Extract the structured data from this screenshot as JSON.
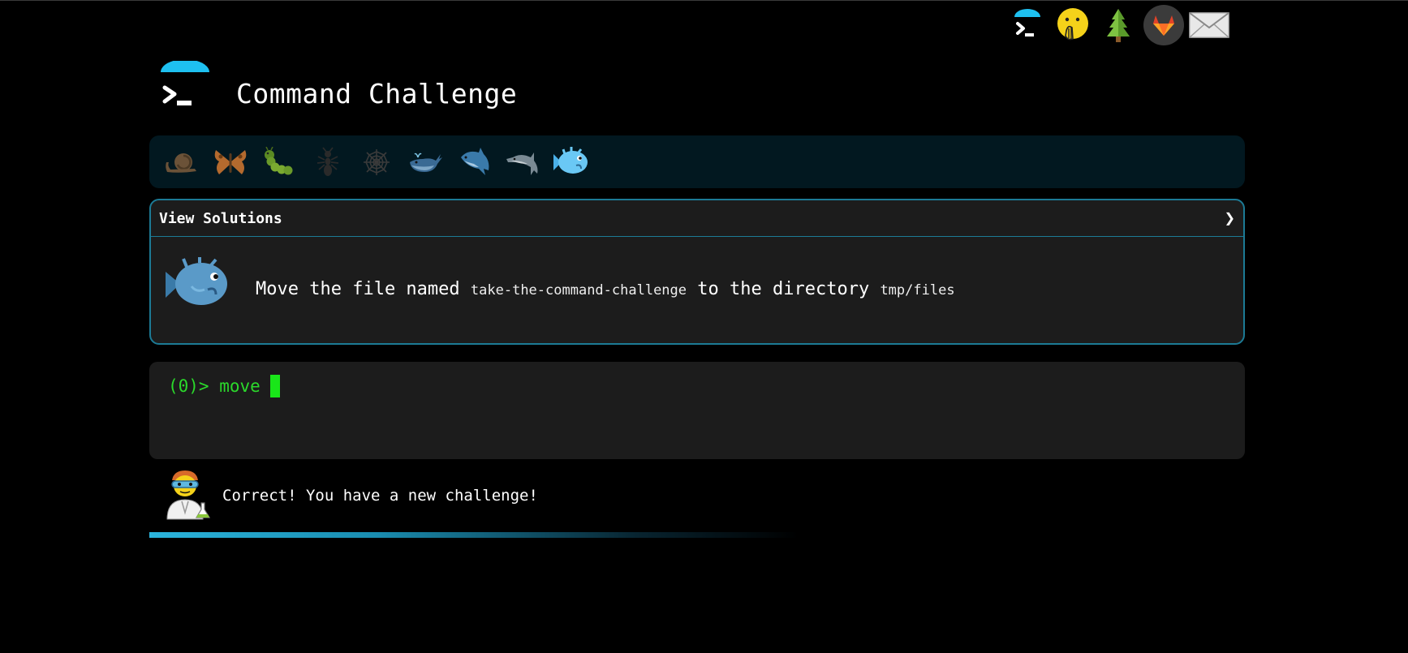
{
  "header": {
    "title": "Command Challenge"
  },
  "top_nav": {
    "items": [
      {
        "name": "terminal-logo-icon"
      },
      {
        "name": "hand-over-mouth-icon"
      },
      {
        "name": "tree-icon"
      },
      {
        "name": "gitlab-icon"
      },
      {
        "name": "mail-icon"
      }
    ]
  },
  "levels": {
    "items": [
      "snail",
      "butterfly",
      "caterpillar",
      "ant",
      "spider-web",
      "whale",
      "shark",
      "dolphin",
      "blowfish"
    ],
    "current": "blowfish"
  },
  "solutions_panel": {
    "label": "View Solutions",
    "chevron": "❯",
    "challenge": {
      "prefix": "Move the file named ",
      "file": "take-the-command-challenge",
      "middle": " to the directory ",
      "dir": "tmp/files"
    }
  },
  "terminal": {
    "prompt": "(0)> ",
    "command": "move"
  },
  "feedback": {
    "message": "Correct! You have a new challenge!",
    "progress": 0.5
  },
  "colors": {
    "accent": "#1c7a95",
    "terminal_green": "#2bd92b",
    "logo_blue": "#1ec0f0"
  }
}
